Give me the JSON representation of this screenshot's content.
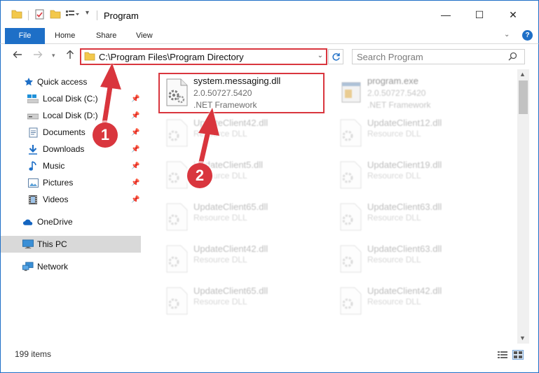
{
  "window": {
    "title": "Program",
    "minimize": "—",
    "maximize": "☐",
    "close": "✕"
  },
  "ribbon": {
    "file": "File",
    "home": "Home",
    "share": "Share",
    "view": "View",
    "help": "?"
  },
  "address": {
    "path": "C:\\Program Files\\Program Directory",
    "search_placeholder": "Search Program"
  },
  "nav": {
    "quick_access": "Quick access",
    "items": [
      {
        "label": "Local Disk (C:)",
        "pinned": true
      },
      {
        "label": "Local Disk (D:)",
        "pinned": true
      },
      {
        "label": "Documents",
        "pinned": true
      },
      {
        "label": "Downloads",
        "pinned": true
      },
      {
        "label": "Music",
        "pinned": true
      },
      {
        "label": "Pictures",
        "pinned": true
      },
      {
        "label": "Videos",
        "pinned": true
      }
    ],
    "onedrive": "OneDrive",
    "this_pc": "This PC",
    "network": "Network"
  },
  "files": [
    {
      "name": "system.messaging.dll",
      "line2": "2.0.50727.5420",
      "line3": ".NET Framework",
      "highlighted": true,
      "icon": "dll-gear-icon"
    },
    {
      "name": "program.exe",
      "line2": "2.0.50727.5420",
      "line3": ".NET Framework",
      "highlighted": false,
      "icon": "exe-icon"
    },
    {
      "name": "UpdateClient42.dll",
      "line2": "Resource DLL",
      "icon": "dll-gear-icon"
    },
    {
      "name": "UpdateClient12.dll",
      "line2": "Resource DLL",
      "icon": "dll-gear-icon"
    },
    {
      "name": "UpdateClient5.dll",
      "line2": "Resource DLL",
      "icon": "dll-gear-icon"
    },
    {
      "name": "UpdateClient19.dll",
      "line2": "Resource DLL",
      "icon": "dll-gear-icon"
    },
    {
      "name": "UpdateClient65.dll",
      "line2": "Resource DLL",
      "icon": "dll-gear-icon"
    },
    {
      "name": "UpdateClient63.dll",
      "line2": "Resource DLL",
      "icon": "dll-gear-icon"
    },
    {
      "name": "UpdateClient42.dll",
      "line2": "Resource DLL",
      "icon": "dll-gear-icon"
    },
    {
      "name": "UpdateClient63.dll",
      "line2": "Resource DLL",
      "icon": "dll-gear-icon"
    },
    {
      "name": "UpdateClient65.dll",
      "line2": "Resource DLL",
      "icon": "dll-gear-icon"
    },
    {
      "name": "UpdateClient42.dll",
      "line2": "Resource DLL",
      "icon": "dll-gear-icon"
    }
  ],
  "status": {
    "count": "199 items"
  },
  "annotations": {
    "step1": "1",
    "step2": "2"
  },
  "colors": {
    "accent": "#1e6fc7",
    "highlight": "#d9363e"
  }
}
